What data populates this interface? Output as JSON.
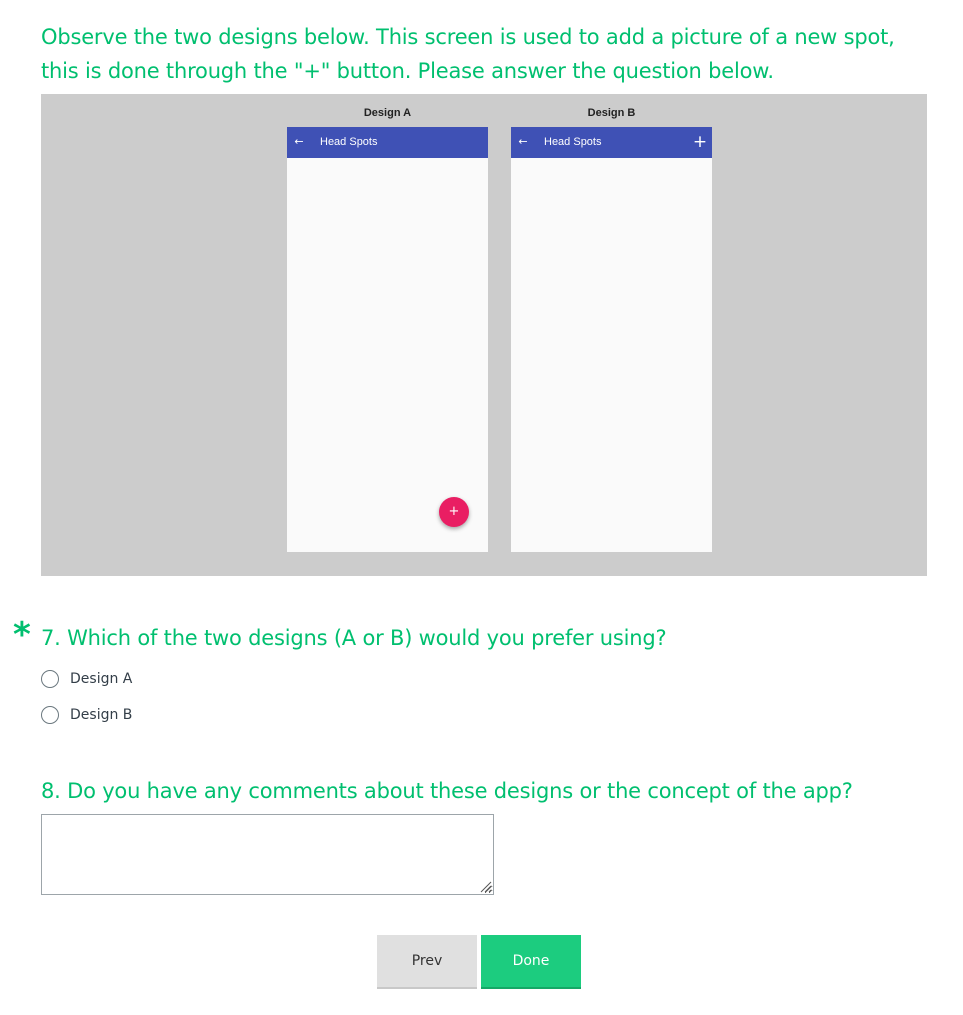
{
  "intro": {
    "line1": "Observe the two designs below. This screen is used to add a picture of a new spot,",
    "line2": "this is done through the \"+\" button. Please answer the question below."
  },
  "figure": {
    "design_a": {
      "label": "Design A",
      "appbar_title": "Head Spots",
      "back_glyph": "←",
      "fab_glyph": "+"
    },
    "design_b": {
      "label": "Design B",
      "appbar_title": "Head Spots",
      "back_glyph": "←",
      "add_glyph": "+"
    },
    "colors": {
      "appbar": "#3f51b5",
      "fab": "#e91e63",
      "panel_bg": "#cccccc",
      "screen_bg": "#fafafa"
    }
  },
  "q7": {
    "required_mark": "*",
    "text": "7. Which of the two designs (A or B) would you prefer using?",
    "options": [
      "Design A",
      "Design B"
    ]
  },
  "q8": {
    "text": "8. Do you have any comments about these designs or the concept of the app?",
    "value": ""
  },
  "nav": {
    "prev_label": "Prev",
    "done_label": "Done"
  },
  "theme": {
    "accent": "#00bf6f",
    "done_button": "#1ccc7f"
  }
}
